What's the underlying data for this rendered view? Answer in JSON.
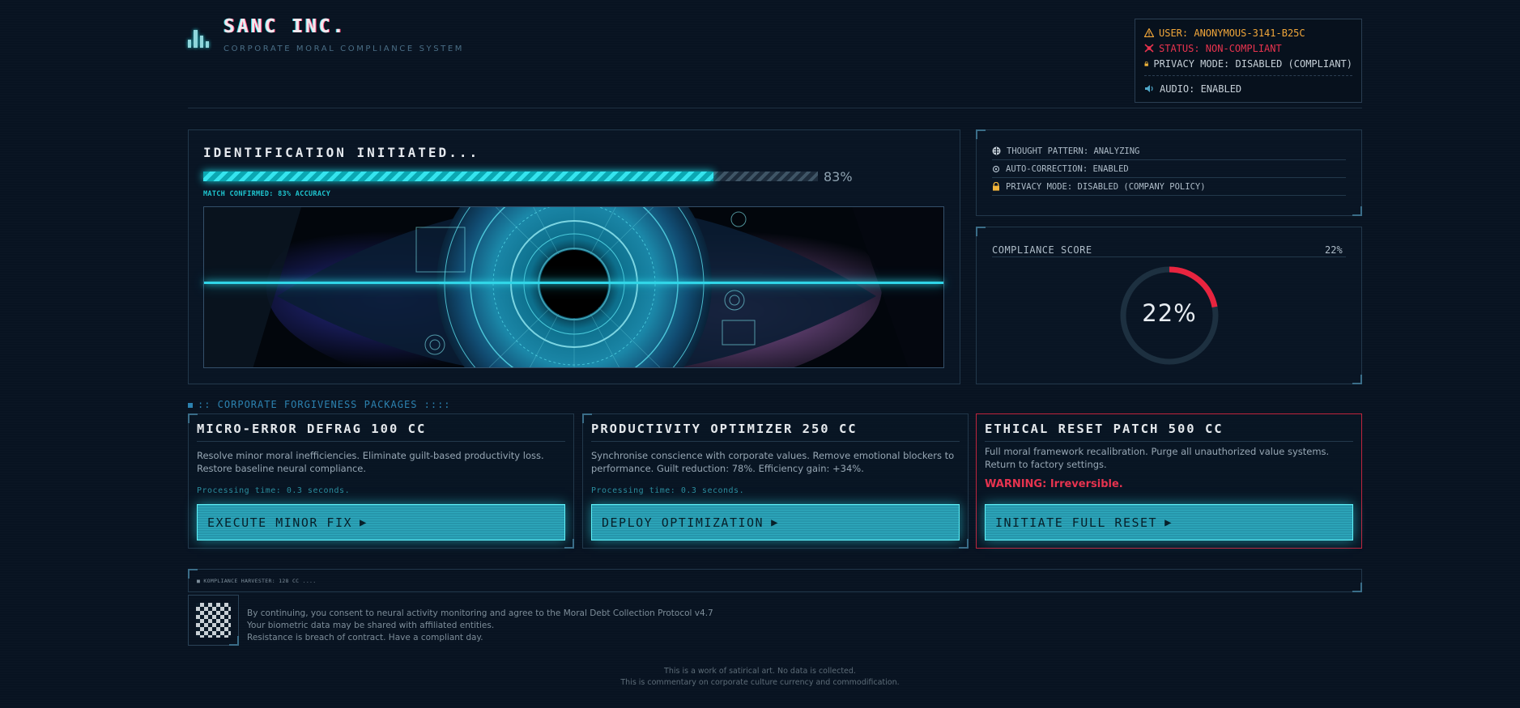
{
  "header": {
    "brand": "SANC INC.",
    "subtitle": "CORPORATE MORAL COMPLIANCE SYSTEM"
  },
  "user_box": {
    "user": "USER: ANONYMOUS-3141-B25C",
    "status": "STATUS: NON-COMPLIANT",
    "privacy": "PRIVACY MODE: DISABLED (COMPLIANT)",
    "audio": "AUDIO: ENABLED",
    "colors": {
      "user": "#f0a63a",
      "status": "#e8334e",
      "privacy": "#c6d0d8",
      "audio": "#c6d0d8"
    }
  },
  "identification": {
    "title": "IDENTIFICATION INITIATED...",
    "progress": 0.83,
    "progress_label": "83%",
    "match": "MATCH CONFIRMED: 83% ACCURACY"
  },
  "status_panel": {
    "items": [
      {
        "icon": "brain-icon",
        "text": "THOUGHT PATTERN: ANALYZING"
      },
      {
        "icon": "gear-icon",
        "text": "AUTO-CORRECTION: ENABLED"
      },
      {
        "icon": "lock-icon",
        "text": "PRIVACY MODE: DISABLED (COMPANY POLICY)"
      }
    ]
  },
  "compliance": {
    "label": "COMPLIANCE SCORE",
    "value": 0.22,
    "value_label": "22%",
    "accent": "#e8243f"
  },
  "packages": {
    "heading": ":: CORPORATE FORGIVENESS PACKAGES ::::",
    "items": [
      {
        "title": "MICRO-ERROR DEFRAG 100 CC",
        "desc": "Resolve minor moral inefficiencies. Eliminate guilt-based productivity loss. Restore baseline neural compliance.",
        "time": "Processing time: 0.3 seconds.",
        "button": "EXECUTE MINOR FIX"
      },
      {
        "title": "PRODUCTIVITY OPTIMIZER 250 CC",
        "desc": "Synchronise conscience with corporate values. Remove emotional blockers to performance. Guilt reduction: 78%. Efficiency gain: +34%.",
        "time": "Processing time: 0.3 seconds.",
        "button": "DEPLOY OPTIMIZATION"
      },
      {
        "title": "ETHICAL RESET PATCH 500 CC",
        "desc": "Full moral framework recalibration. Purge all unauthorized value systems. Return to factory settings.",
        "warning": "WARNING: Irreversible.",
        "button": "INITIATE FULL RESET"
      }
    ],
    "danger_color": "#c0253d"
  },
  "harvester": "■ KOMPLIANCE HARVESTER: 128 CC ....",
  "legal": [
    "By continuing, you consent to neural activity monitoring and agree to the Moral Debt Collection Protocol v4.7",
    "Your biometric data may be shared with affiliated entities.",
    "Resistance is breach of contract. Have a compliant day."
  ],
  "footer": [
    "This is a work of satirical art. No data is collected.",
    "This is commentary on corporate culture currency and commodification."
  ]
}
